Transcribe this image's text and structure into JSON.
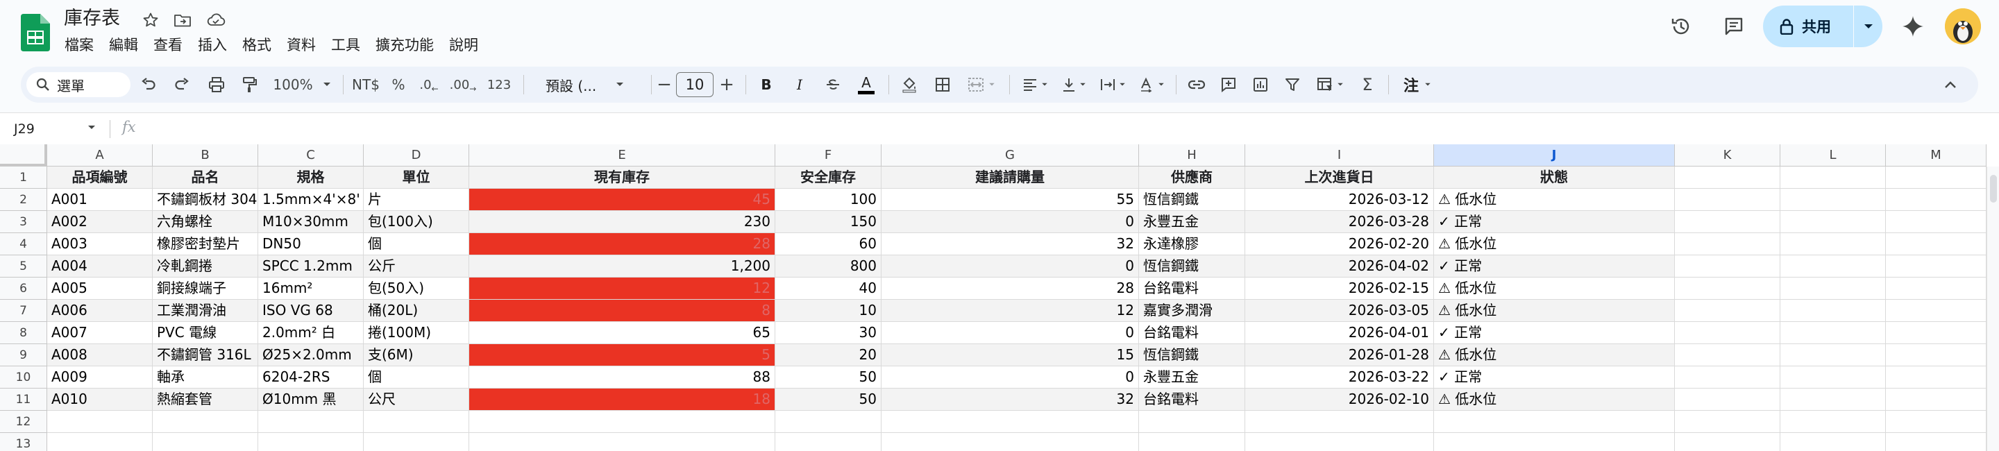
{
  "doc": {
    "title": "庫存表"
  },
  "menu": [
    "檔案",
    "編輯",
    "查看",
    "插入",
    "格式",
    "資料",
    "工具",
    "擴充功能",
    "說明"
  ],
  "share": {
    "label": "共用"
  },
  "toolbar": {
    "search_label": "選單",
    "zoom": "100%",
    "currency": "NT$",
    "percent": "%",
    "dec_decrease": ".0",
    "dec_increase": ".00",
    "number_format": "123",
    "font_name": "預設 (...",
    "font_size": "10",
    "bold": "B",
    "italic": "I",
    "text_color": "A",
    "sigma": "Σ",
    "input_tool": "注"
  },
  "formula_bar": {
    "cell_ref": "J29",
    "fx": "fx"
  },
  "grid": {
    "columns": [
      "A",
      "B",
      "C",
      "D",
      "E",
      "F",
      "G",
      "H",
      "I",
      "J",
      "K",
      "L",
      "M"
    ],
    "selected_column": "J",
    "row_numbers": [
      "1",
      "2",
      "3",
      "4",
      "5",
      "6",
      "7",
      "8",
      "9",
      "10",
      "11",
      "12",
      "13"
    ],
    "headers": [
      "品項編號",
      "品名",
      "規格",
      "單位",
      "現有庫存",
      "安全庫存",
      "建議請購量",
      "供應商",
      "上次進貨日",
      "狀態"
    ],
    "rows": [
      [
        "A001",
        "不鏽鋼板材 304",
        "1.5mm×4'×8'",
        "片",
        "45",
        "100",
        "55",
        "恆信鋼鐵",
        "2026-03-12",
        "⚠ 低水位"
      ],
      [
        "A002",
        "六角螺栓",
        "M10×30mm",
        "包(100入)",
        "230",
        "150",
        "0",
        "永豐五金",
        "2026-03-28",
        "✓ 正常"
      ],
      [
        "A003",
        "橡膠密封墊片",
        "DN50",
        "個",
        "28",
        "60",
        "32",
        "永達橡膠",
        "2026-02-20",
        "⚠ 低水位"
      ],
      [
        "A004",
        "冷軋鋼捲",
        "SPCC 1.2mm",
        "公斤",
        "1,200",
        "800",
        "0",
        "恆信鋼鐵",
        "2026-04-02",
        "✓ 正常"
      ],
      [
        "A005",
        "銅接線端子",
        "16mm²",
        "包(50入)",
        "12",
        "40",
        "28",
        "台銘電料",
        "2026-02-15",
        "⚠ 低水位"
      ],
      [
        "A006",
        "工業潤滑油",
        "ISO VG 68",
        "桶(20L)",
        "8",
        "10",
        "12",
        "嘉實多潤滑",
        "2026-03-05",
        "⚠ 低水位"
      ],
      [
        "A007",
        "PVC 電線",
        "2.0mm² 白",
        "捲(100M)",
        "65",
        "30",
        "0",
        "台銘電料",
        "2026-04-01",
        "✓ 正常"
      ],
      [
        "A008",
        "不鏽鋼管 316L",
        "Ø25×2.0mm",
        "支(6M)",
        "5",
        "20",
        "15",
        "恆信鋼鐵",
        "2026-01-28",
        "⚠ 低水位"
      ],
      [
        "A009",
        "軸承",
        "6204-2RS",
        "個",
        "88",
        "50",
        "0",
        "永豐五金",
        "2026-03-22",
        "✓ 正常"
      ],
      [
        "A010",
        "熱縮套管",
        "Ø10mm 黑",
        "公尺",
        "18",
        "50",
        "32",
        "台銘電料",
        "2026-02-10",
        "⚠ 低水位"
      ]
    ],
    "low_stock_rows": [
      0,
      2,
      4,
      5,
      7,
      9
    ],
    "colors": {
      "low_stock_fill": "#ea3323",
      "low_stock_text": "#e06666",
      "selected_column": "#d3e3fd",
      "accent": "#0b57d0"
    }
  }
}
